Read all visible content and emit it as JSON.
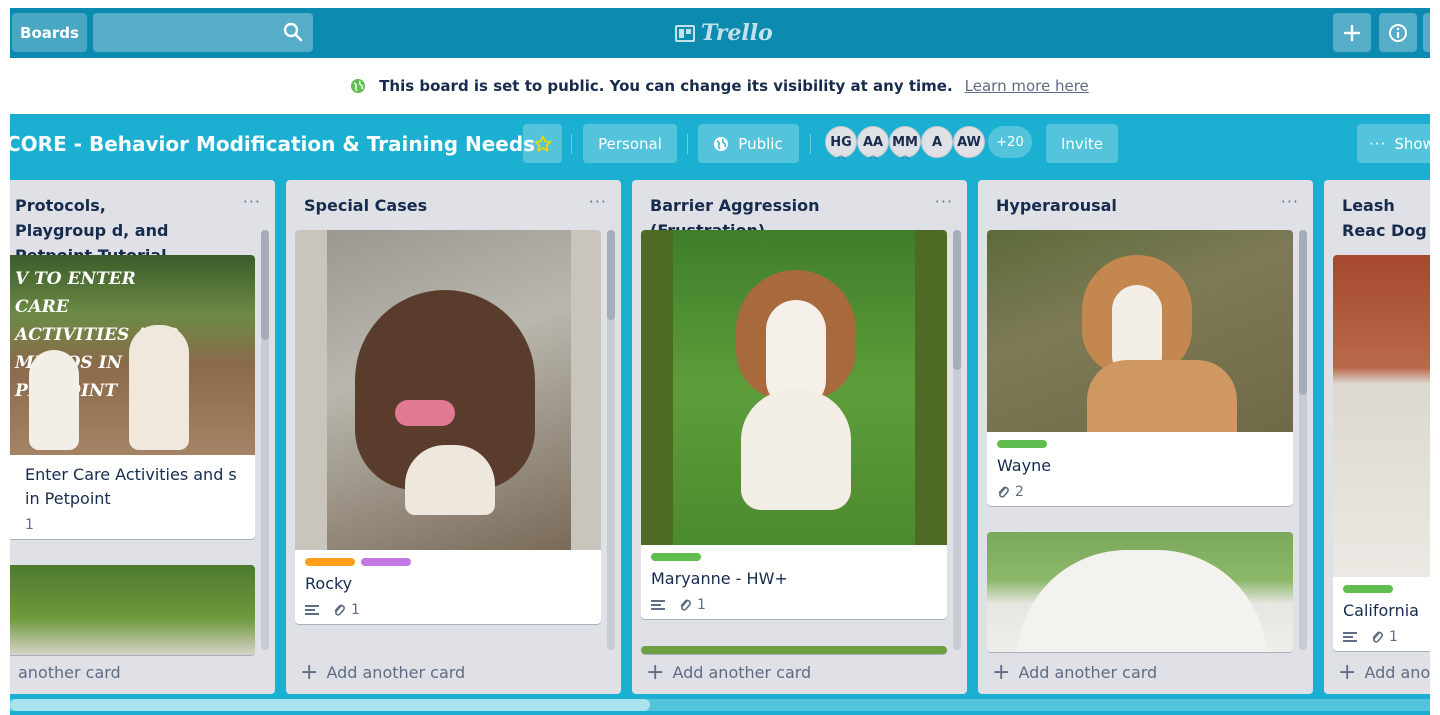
{
  "header": {
    "boards_label": "Boards",
    "logo_text": "Trello",
    "add_icon": "plus-icon",
    "info_icon": "info-icon"
  },
  "notice": {
    "text": "This board is set to public. You can change its visibility at any time.",
    "link": "Learn more here"
  },
  "board": {
    "title": "CORE - Behavior Modification & Training Needs",
    "team": "Personal",
    "visibility": "Public",
    "members": [
      "HG",
      "AA",
      "MM",
      "A",
      "AW"
    ],
    "more_members": "+20",
    "invite": "Invite",
    "show_menu": "Show"
  },
  "lists": [
    {
      "title": "Protocols, Playgroup d, and Petpoint Tutorial",
      "cards": [
        {
          "cover_text": "V TO ENTER CARE ACTIVITIES AND MEMOS IN PETPOINT",
          "title": "Enter Care Activities and s in Petpoint",
          "attachments": "1"
        }
      ],
      "add": "another card"
    },
    {
      "title": "Special Cases",
      "cards": [
        {
          "title": "Rocky",
          "attachments": "1"
        }
      ],
      "add": "Add another card"
    },
    {
      "title": "Barrier Aggression (Frustration)",
      "cards": [
        {
          "title": "Maryanne - HW+",
          "attachments": "1"
        }
      ],
      "add": "Add another card"
    },
    {
      "title": "Hyperarousal",
      "cards": [
        {
          "title": "Wayne",
          "attachments": "2"
        }
      ],
      "add": "Add another card"
    },
    {
      "title": "Leash Reac Dog",
      "cards": [
        {
          "title": "California",
          "attachments": "1"
        }
      ],
      "add": "Add anot"
    }
  ],
  "colors": {
    "header": "#0c8ab0",
    "board": "#1bb0d2",
    "label_green": "#61bd4f",
    "label_orange": "#ff9f1a",
    "label_purple": "#c377e0"
  }
}
